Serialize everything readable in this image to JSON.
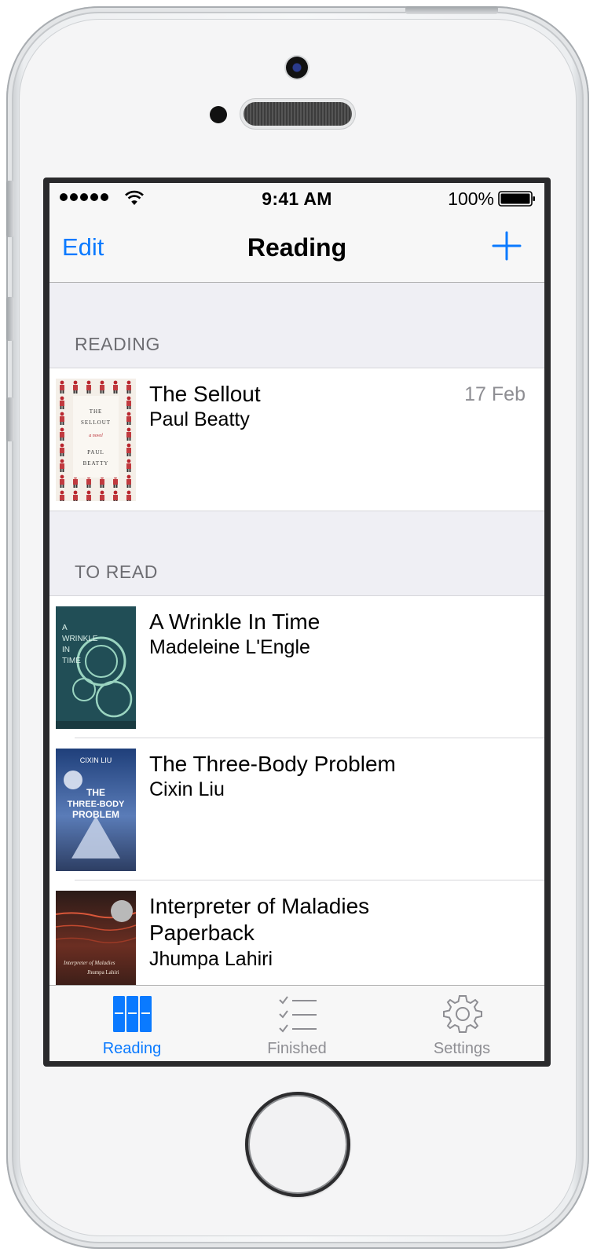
{
  "status_bar": {
    "time": "9:41 AM",
    "battery": "100%",
    "icons": [
      "signal-dots-icon",
      "wifi-icon",
      "battery-icon"
    ]
  },
  "nav": {
    "edit_label": "Edit",
    "title": "Reading",
    "add_icon": "plus-icon"
  },
  "sections": [
    {
      "header": "READING",
      "books": [
        {
          "title": "The Sellout",
          "author": "Paul Beatty",
          "date": "17 Feb"
        }
      ]
    },
    {
      "header": "TO READ",
      "books": [
        {
          "title": "A Wrinkle In Time",
          "author": "Madeleine L'Engle"
        },
        {
          "title": "The Three-Body Problem",
          "author": "Cixin Liu"
        },
        {
          "title": "Interpreter of Maladies Paperback",
          "author": "Jhumpa Lahiri"
        }
      ]
    }
  ],
  "tabs": [
    {
      "label": "Reading",
      "icon": "books-icon",
      "selected": true
    },
    {
      "label": "Finished",
      "icon": "checklist-icon",
      "selected": false
    },
    {
      "label": "Settings",
      "icon": "gear-icon",
      "selected": false
    }
  ],
  "colors": {
    "tint": "#0a7aff",
    "inactive": "#8e8e93",
    "background": "#efeff4"
  }
}
